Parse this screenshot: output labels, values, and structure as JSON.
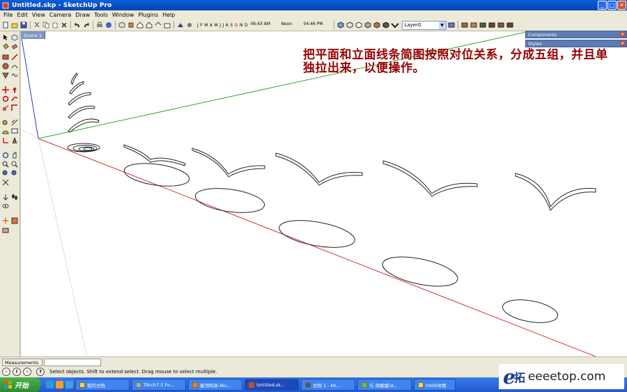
{
  "window": {
    "title": "Untitled.skp - SketchUp Pro",
    "controls": [
      "_",
      "□",
      "✕"
    ]
  },
  "menu": [
    "File",
    "Edit",
    "View",
    "Camera",
    "Draw",
    "Tools",
    "Window",
    "Plugins",
    "Help"
  ],
  "toolbar": {
    "months": [
      "J",
      "F",
      "M",
      "A",
      "M",
      "J",
      "J",
      "A",
      "S",
      "O",
      "N",
      "D"
    ],
    "time_start": "06:43 AM",
    "time_mid": "Noon",
    "time_end": "04:46 PM",
    "layer": "Layer0"
  },
  "scene": {
    "tab": "Scene 1"
  },
  "panels": [
    {
      "label": "Components"
    },
    {
      "label": "Styles"
    }
  ],
  "annotation": "把平面和立面线条简图按照对位关系，分成五组，并且单独拉出来，以便操作。",
  "measurements": {
    "label": "Measurements",
    "value": ""
  },
  "status": {
    "text": "Select objects. Shift to extend select. Drag mouse to select multiple."
  },
  "taskbar": {
    "start": "开始",
    "tasks": [
      "我的文档",
      "TArch7.5 Fo...",
      "屋顶构架-Mo...",
      "Untitled.sk...",
      "文档 1 - Mi...",
      "与 周媛媛(A...",
      "0906导图"
    ],
    "active_index": 3
  },
  "watermark": {
    "logo": "e",
    "han": "拓",
    "domain": "eeeetop.com"
  },
  "colors": {
    "red_axis": "#cc3333",
    "green_axis": "#33aa33",
    "blue_axis": "#3333cc",
    "annotation": "#990000"
  }
}
